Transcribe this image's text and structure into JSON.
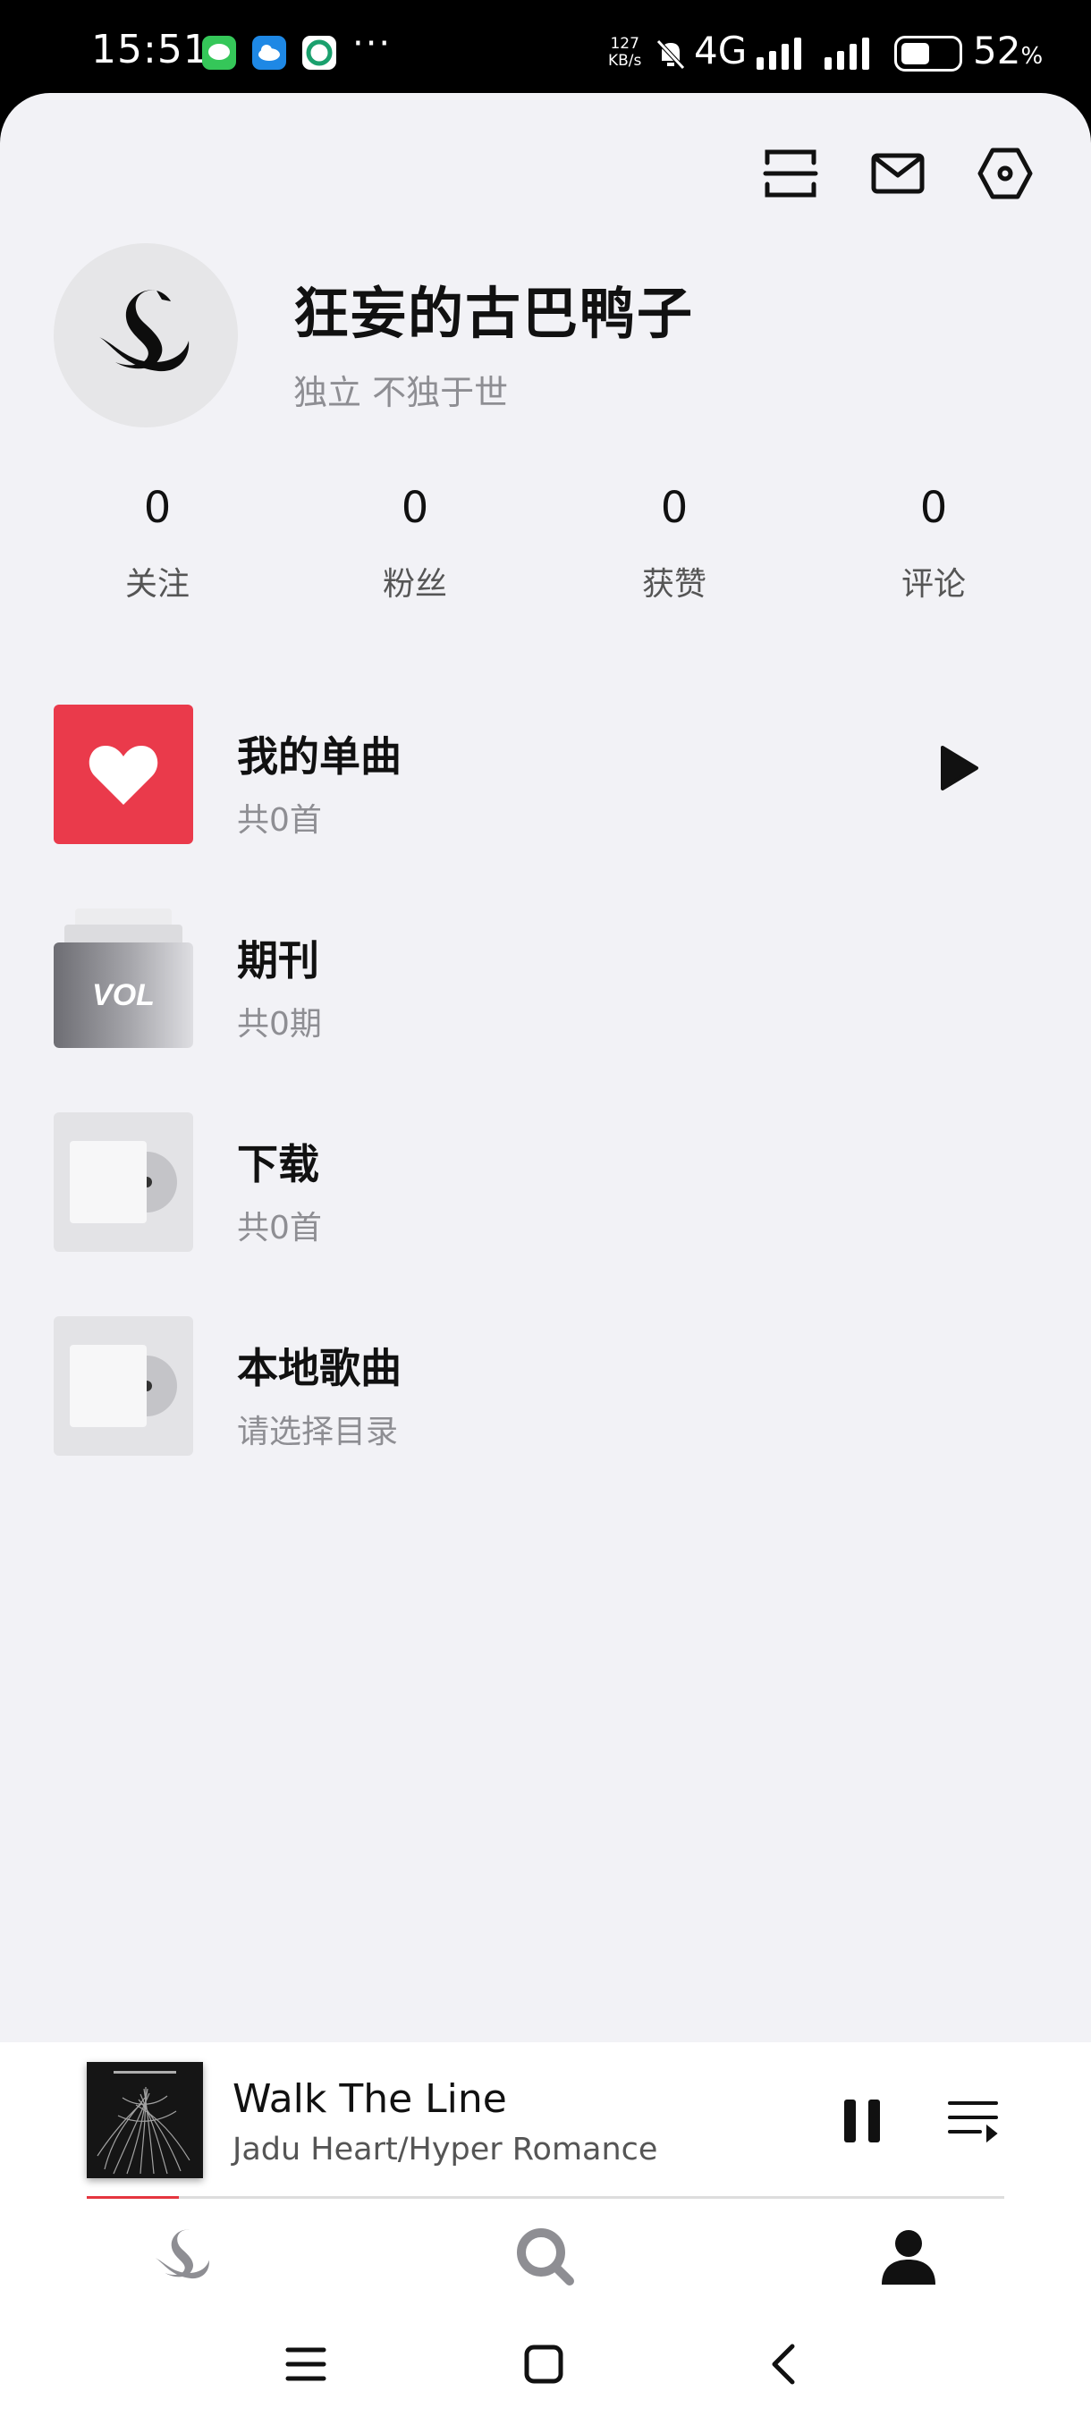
{
  "status_bar": {
    "time": "15:51",
    "overflow": "···",
    "speed_value": "127",
    "speed_unit": "KB/s",
    "network": "4G",
    "battery_value": "52",
    "battery_unit": "%",
    "battery_level": 0.52,
    "app_icons": [
      "messages-icon",
      "cloud-icon",
      "green-app-icon"
    ]
  },
  "header_icons": [
    "scan-icon",
    "mail-icon",
    "settings-icon"
  ],
  "profile": {
    "name": "狂妄的古巴鸭子",
    "bio": "独立 不独于世"
  },
  "stats": [
    {
      "value": "0",
      "label": "关注"
    },
    {
      "value": "0",
      "label": "粉丝"
    },
    {
      "value": "0",
      "label": "获赞"
    },
    {
      "value": "0",
      "label": "评论"
    }
  ],
  "library": [
    {
      "title": "我的单曲",
      "subtitle": "共0首"
    },
    {
      "title": "期刊",
      "subtitle": "共0期",
      "thumb_text": "VOL"
    },
    {
      "title": "下载",
      "subtitle": "共0首"
    },
    {
      "title": "本地歌曲",
      "subtitle": "请选择目录"
    }
  ],
  "player": {
    "song": "Walk The Line",
    "artist": "Jadu Heart/Hyper Romance",
    "progress": 0.1
  },
  "tabs": [
    "swan-icon",
    "search-icon",
    "profile-icon"
  ],
  "colors": {
    "accent": "#ea3a4b",
    "background": "#f2f2f6"
  }
}
